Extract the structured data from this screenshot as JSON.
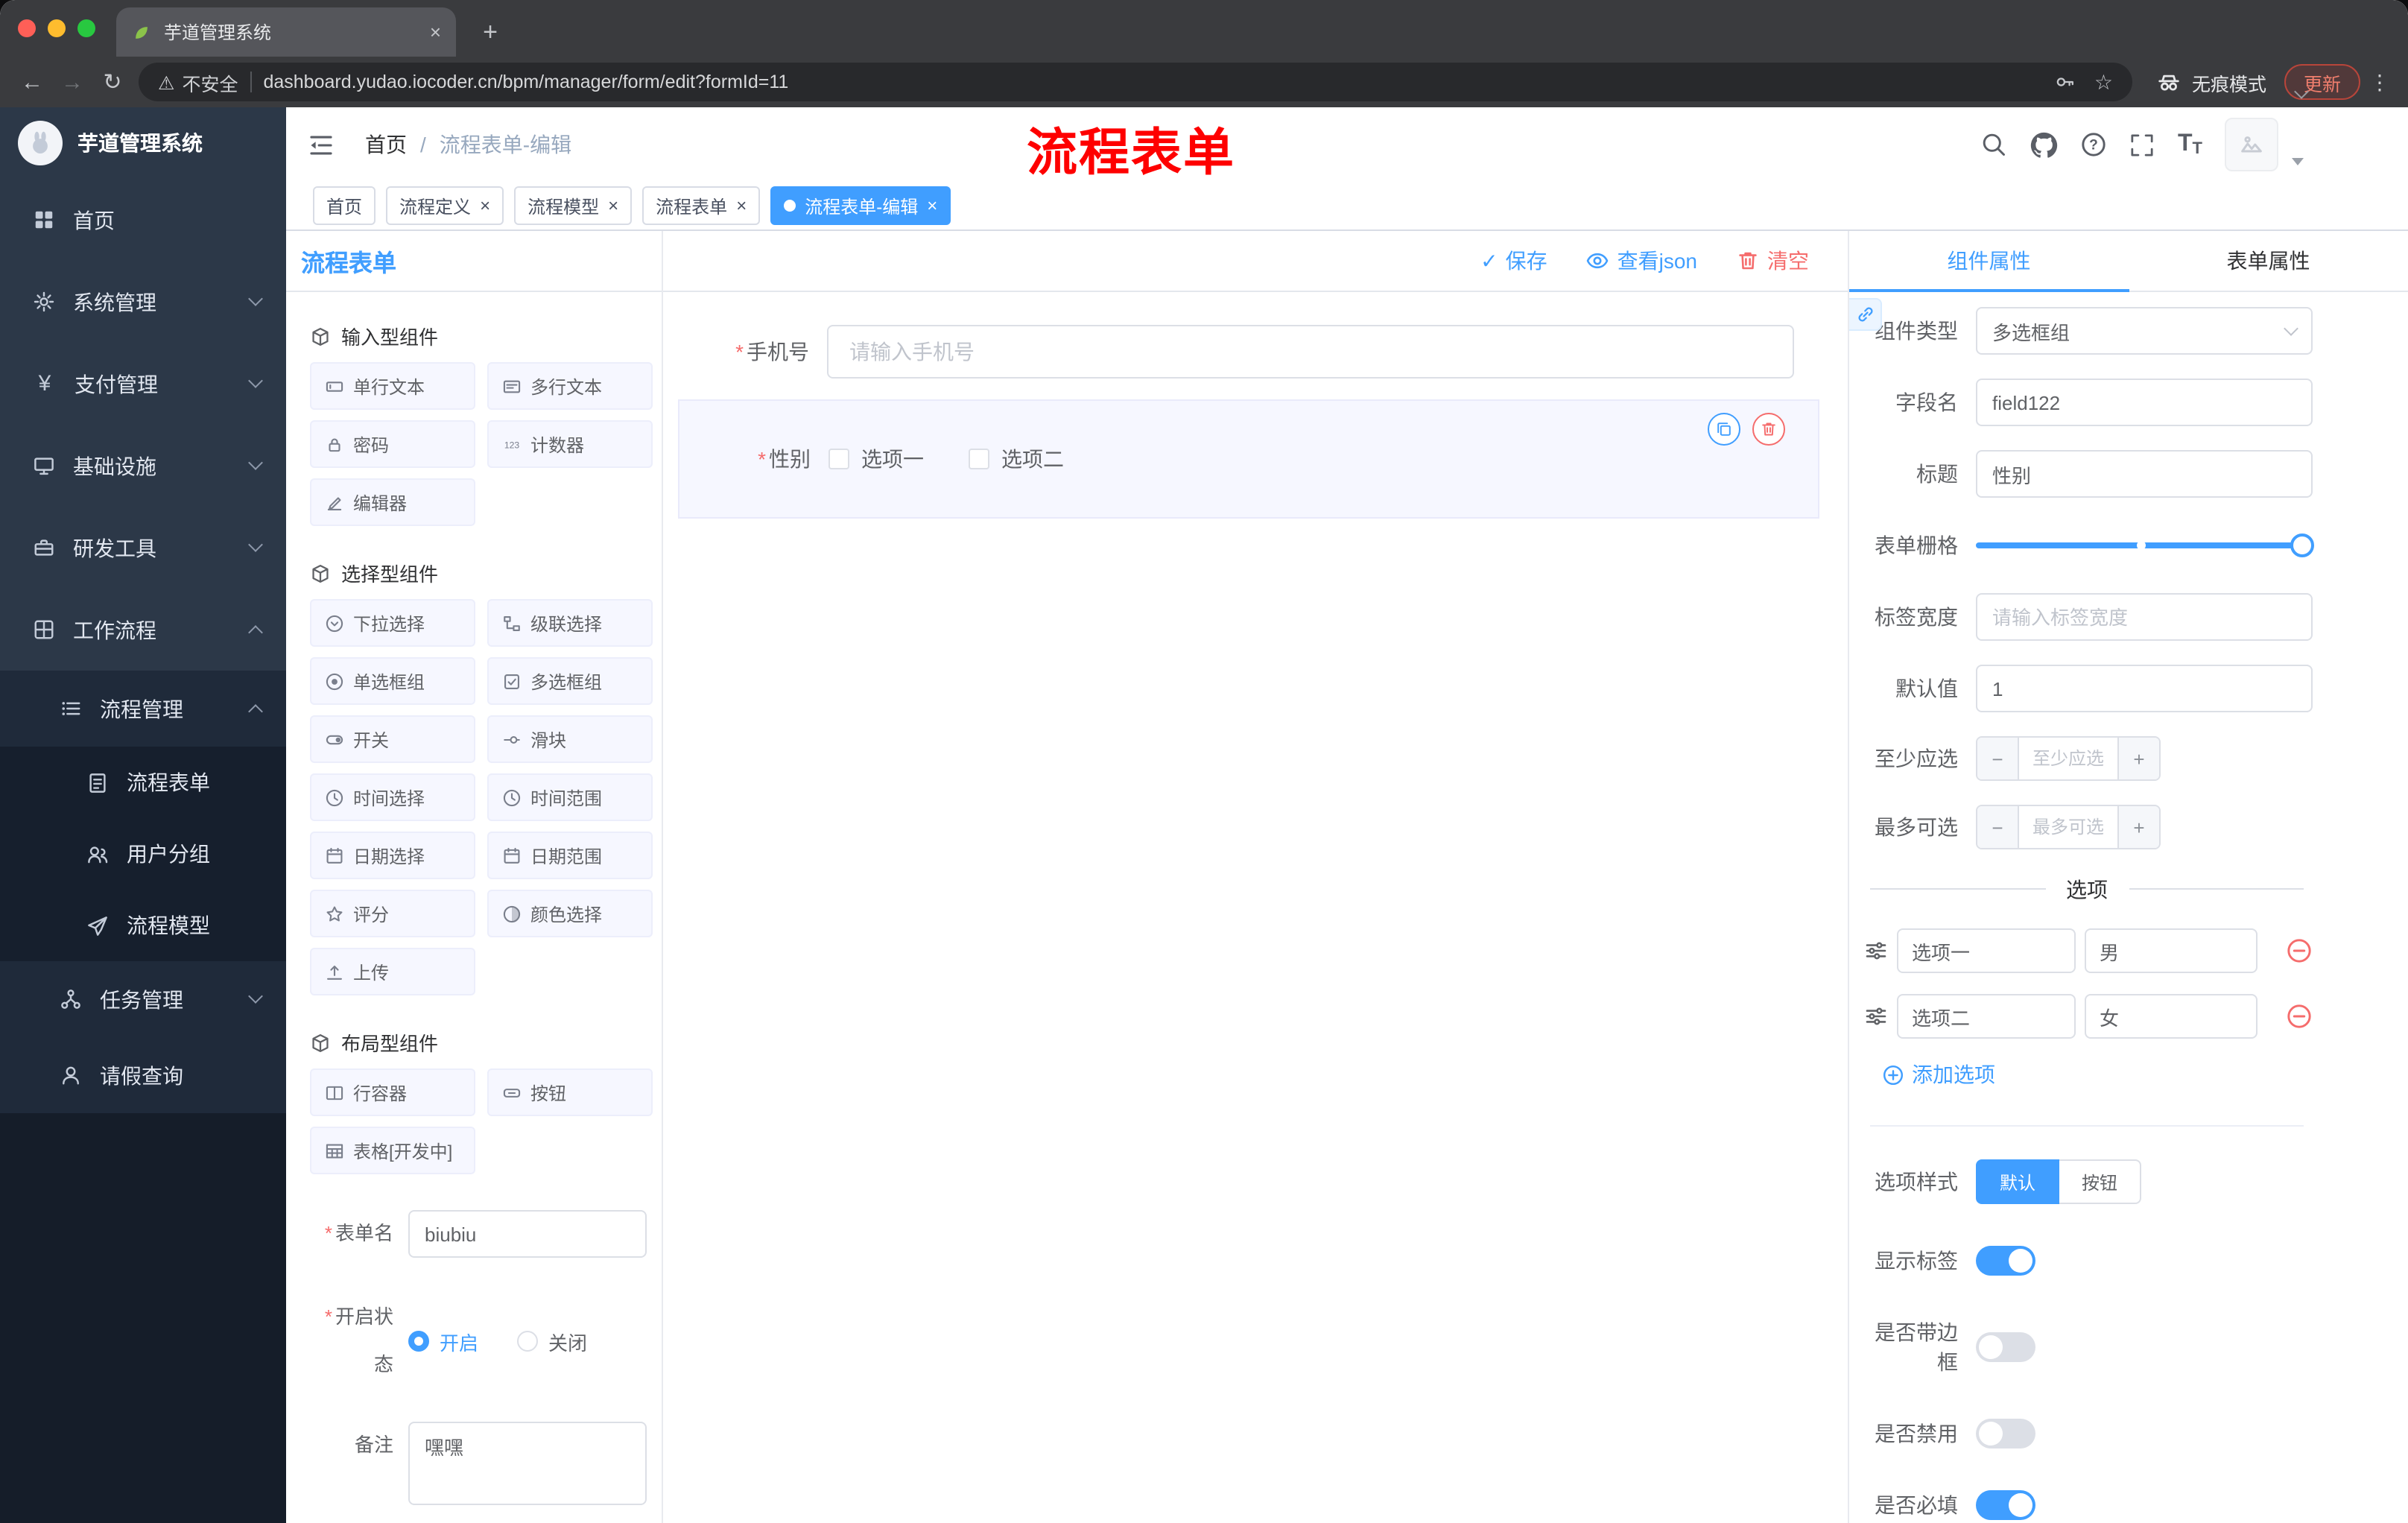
{
  "browser": {
    "tab_title": "芋道管理系统",
    "security_label": "不安全",
    "url": "dashboard.yudao.iocoder.cn/bpm/manager/form/edit?formId=11",
    "incognito_label": "无痕模式",
    "update_label": "更新"
  },
  "glyphs": {
    "close": "×",
    "new_tab": "+",
    "back": "←",
    "forward": "→",
    "reload": "↻",
    "warning": "⚠",
    "star": "☆",
    "kebab": "⋮",
    "check": "✓",
    "sep": "/",
    "minus": "−",
    "plus": "+",
    "required": "*",
    "font_large": "T",
    "font_small": "T"
  },
  "sidebar": {
    "app_title": "芋道管理系统",
    "items": [
      {
        "label": "首页"
      },
      {
        "label": "系统管理"
      },
      {
        "label": "支付管理"
      },
      {
        "label": "基础设施"
      },
      {
        "label": "研发工具"
      },
      {
        "label": "工作流程"
      },
      {
        "label": "流程管理"
      },
      {
        "label": "流程表单",
        "active": true
      },
      {
        "label": "用户分组"
      },
      {
        "label": "流程模型"
      },
      {
        "label": "任务管理"
      },
      {
        "label": "请假查询"
      }
    ]
  },
  "header": {
    "breadcrumb": [
      {
        "label": "首页"
      },
      {
        "label": "流程表单-编辑"
      }
    ],
    "annotation": "流程表单"
  },
  "tags": [
    {
      "label": "首页"
    },
    {
      "label": "流程定义",
      "closable": true
    },
    {
      "label": "流程模型",
      "closable": true
    },
    {
      "label": "流程表单",
      "closable": true
    },
    {
      "label": "流程表单-编辑",
      "closable": true,
      "active": true
    }
  ],
  "designer": {
    "panel_title": "流程表单",
    "actions": {
      "save": "保存",
      "view_json": "查看json",
      "clear": "清空"
    },
    "palette": {
      "sections": [
        {
          "title": "输入型组件",
          "items": [
            {
              "label": "单行文本"
            },
            {
              "label": "多行文本"
            },
            {
              "label": "密码"
            },
            {
              "label": "计数器"
            },
            {
              "label": "编辑器"
            }
          ]
        },
        {
          "title": "选择型组件",
          "items": [
            {
              "label": "下拉选择"
            },
            {
              "label": "级联选择"
            },
            {
              "label": "单选框组"
            },
            {
              "label": "多选框组"
            },
            {
              "label": "开关"
            },
            {
              "label": "滑块"
            },
            {
              "label": "时间选择"
            },
            {
              "label": "时间范围"
            },
            {
              "label": "日期选择"
            },
            {
              "label": "日期范围"
            },
            {
              "label": "评分"
            },
            {
              "label": "颜色选择"
            },
            {
              "label": "上传"
            }
          ]
        },
        {
          "title": "布局型组件",
          "items": [
            {
              "label": "行容器"
            },
            {
              "label": "按钮"
            },
            {
              "label": "表格[开发中]"
            }
          ]
        }
      ]
    },
    "meta": {
      "form_name_label": "表单名",
      "form_name_value": "biubiu",
      "status_label": "开启状态",
      "status_on": "开启",
      "status_off": "关闭",
      "remark_label": "备注",
      "remark_value": "嘿嘿"
    },
    "canvas": {
      "phone_label": "手机号",
      "phone_placeholder": "请输入手机号",
      "gender_label": "性别",
      "gender_options": [
        {
          "label": "选项一"
        },
        {
          "label": "选项二"
        }
      ]
    }
  },
  "properties": {
    "tab_component": "组件属性",
    "tab_form": "表单属性",
    "component_type_label": "组件类型",
    "component_type_value": "多选框组",
    "field_name_label": "字段名",
    "field_name_value": "field122",
    "title_label": "标题",
    "title_value": "性别",
    "grid_label": "表单栅格",
    "label_width_label": "标签宽度",
    "label_width_placeholder": "请输入标签宽度",
    "default_label": "默认值",
    "default_value": "1",
    "min_label": "至少应选",
    "min_placeholder": "至少应选",
    "max_label": "最多可选",
    "max_placeholder": "最多可选",
    "options_title": "选项",
    "options": [
      {
        "name": "选项一",
        "value": "男"
      },
      {
        "name": "选项二",
        "value": "女"
      }
    ],
    "add_option_label": "添加选项",
    "option_style_label": "选项样式",
    "option_style_default": "默认",
    "option_style_button": "按钮",
    "switches": [
      {
        "label": "显示标签",
        "on": true
      },
      {
        "label": "是否带边框",
        "on": false
      },
      {
        "label": "是否禁用",
        "on": false
      },
      {
        "label": "是否必填",
        "on": true
      }
    ],
    "accent_color": "#409eff",
    "danger_color": "#f56c6c"
  }
}
